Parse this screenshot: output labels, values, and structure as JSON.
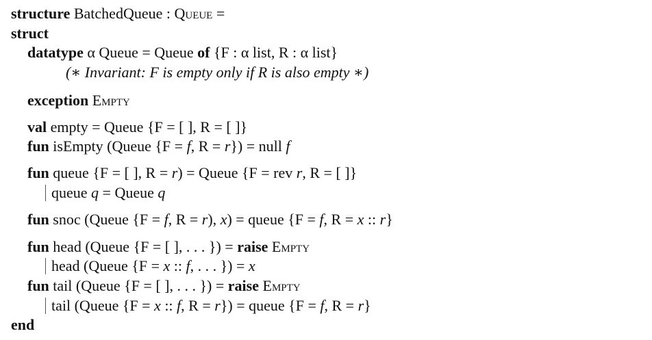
{
  "doc": {
    "l1": {
      "kw": "structure",
      "a": " BatchedQueue : ",
      "sc": "Queue",
      "b": " ="
    },
    "l2": {
      "kw": "struct"
    },
    "l3": {
      "kw": "datatype",
      "a": " α Queue = Queue ",
      "kw2": "of",
      "b": " {F : α list, R : α list}"
    },
    "l4": {
      "a": "(∗ ",
      "it": "Invariant:",
      "b": " F is empty only if R is also empty ∗)"
    },
    "l5": {
      "kw": "exception",
      "sc": " Empty"
    },
    "l6": {
      "kw": "val",
      "a": " empty = Queue {F = [ ], R = [ ]}"
    },
    "l7": {
      "kw": "fun",
      "a": " isEmpty (Queue {F = ",
      "v1": "f",
      "b": ", R = ",
      "v2": "r",
      "c": "}) = null ",
      "v3": "f"
    },
    "l8": {
      "kw": "fun",
      "a": " queue {F = [ ], R = ",
      "v1": "r",
      "b": ") = Queue {F = rev ",
      "v2": "r",
      "c": ", R = [ ]}"
    },
    "l9": {
      "a": "queue ",
      "v1": "q",
      "b": " = Queue ",
      "v2": "q"
    },
    "l10": {
      "kw": "fun",
      "a": " snoc (Queue {F = ",
      "v1": "f",
      "b": ", R = ",
      "v2": "r",
      "c": "), ",
      "v3": "x",
      "d": ") = queue {F = ",
      "v4": "f",
      "e": ", R = ",
      "v5": "x",
      "f": " :: ",
      "v6": "r",
      "g": "}"
    },
    "l11": {
      "kw": "fun",
      "a": " head (Queue {F = [ ], . . . }) = ",
      "kw2": "raise",
      "sc": " Empty"
    },
    "l12": {
      "a": "head (Queue {F = ",
      "v1": "x",
      "b": " :: ",
      "v2": "f",
      "c": ", . . . }) = ",
      "v3": "x"
    },
    "l13": {
      "kw": "fun",
      "a": " tail (Queue {F = [ ], . . . }) = ",
      "kw2": "raise",
      "sc": " Empty"
    },
    "l14": {
      "a": "tail (Queue {F = ",
      "v1": "x",
      "b": " :: ",
      "v2": "f",
      "c": ", R = ",
      "v3": "r",
      "d": "}) = queue {F = ",
      "v4": "f",
      "e": ", R = ",
      "v5": "r",
      "f": "}"
    },
    "l15": {
      "kw": "end"
    }
  }
}
